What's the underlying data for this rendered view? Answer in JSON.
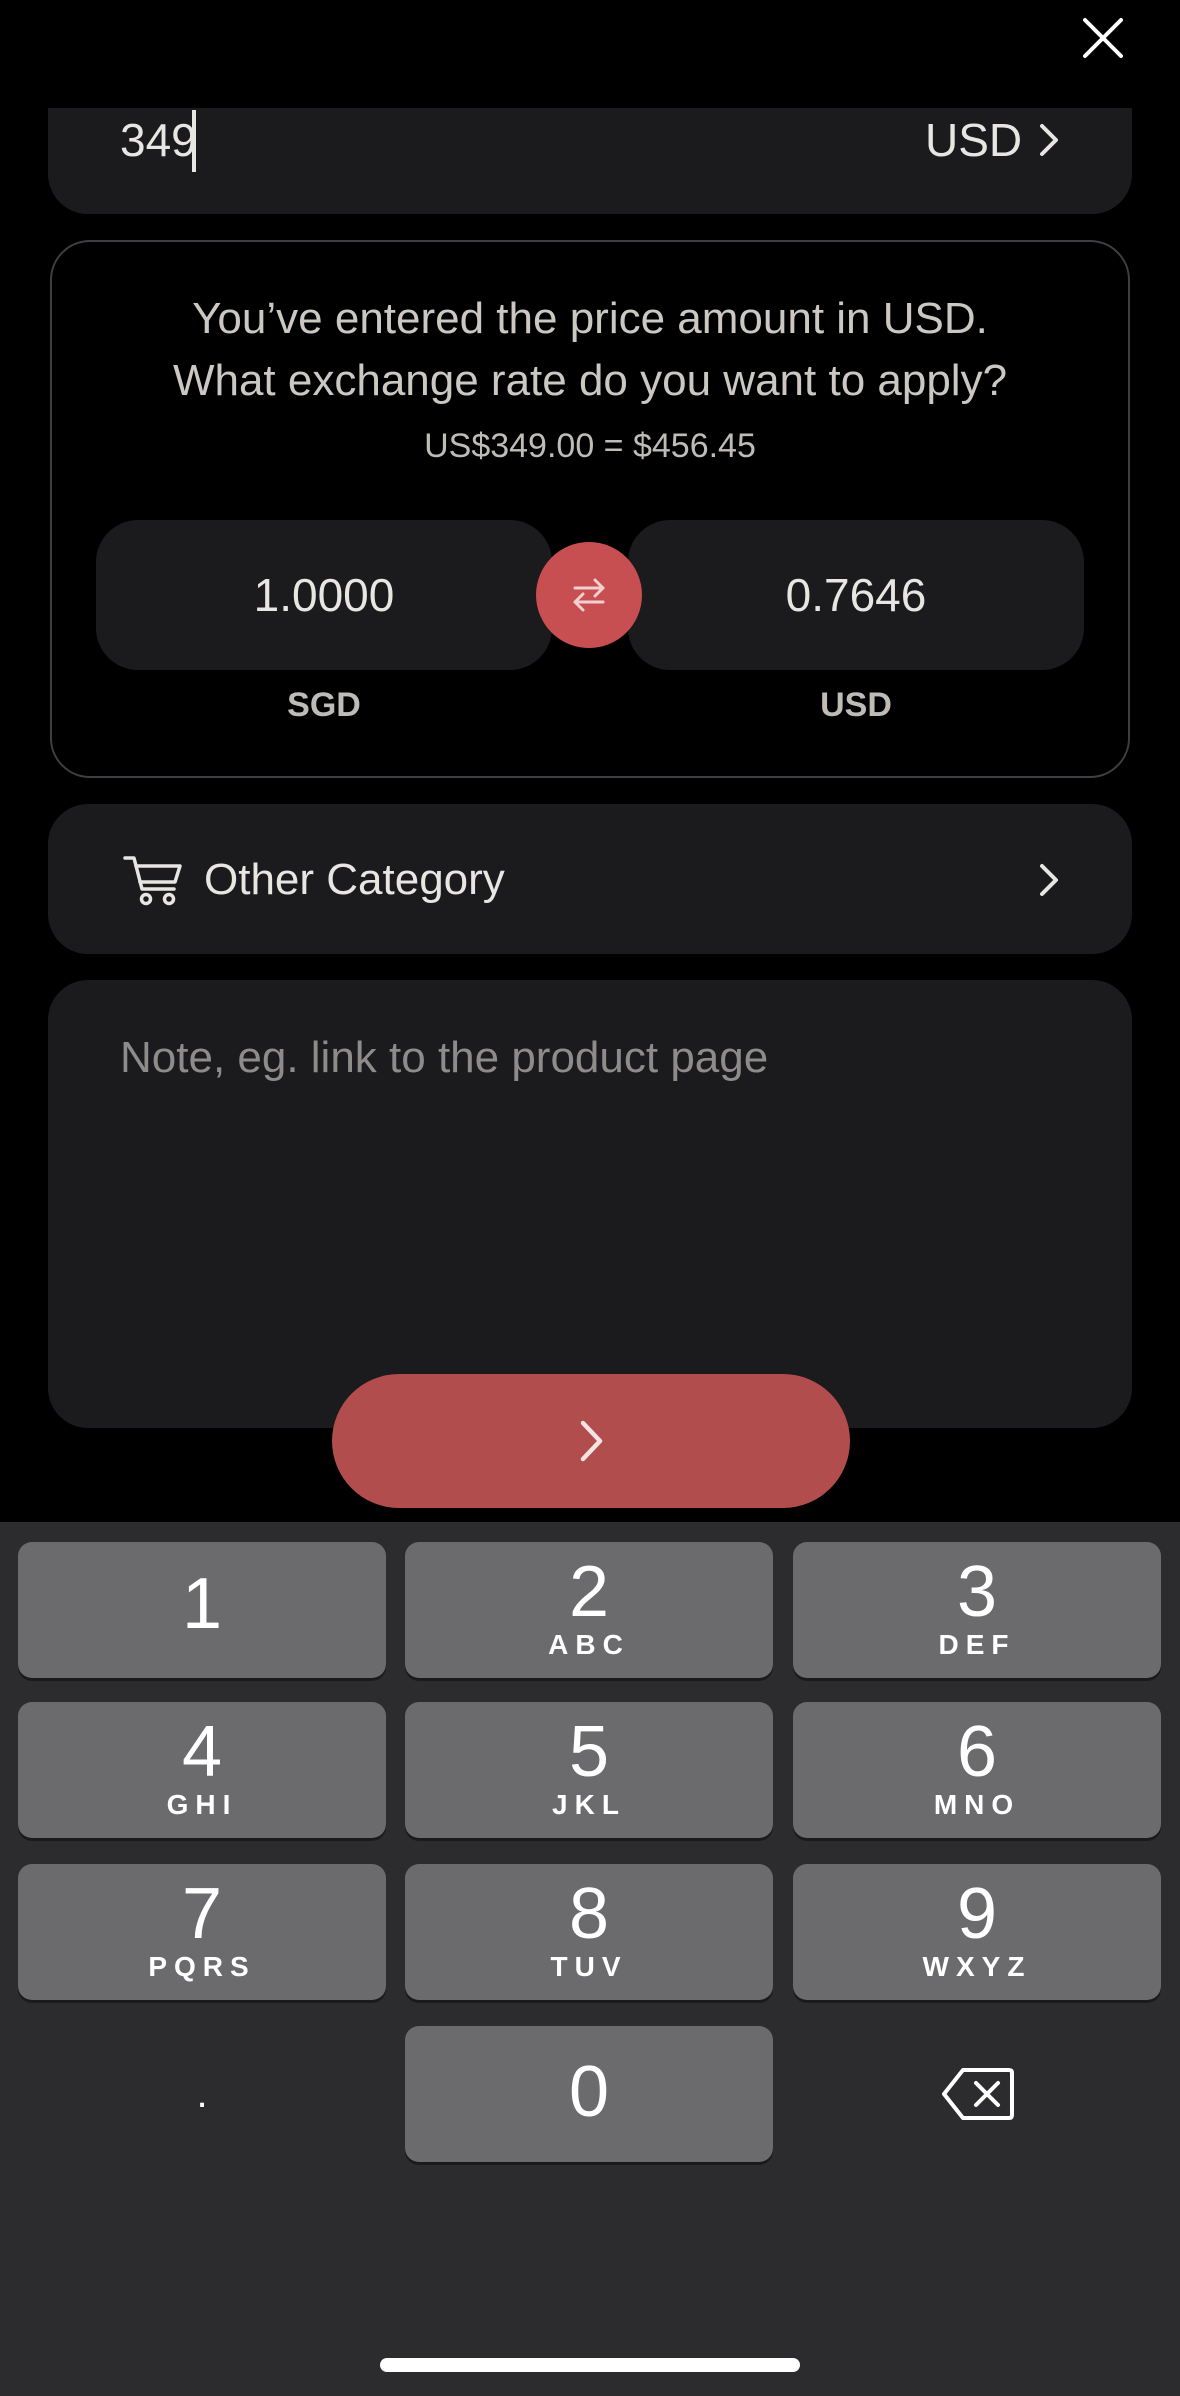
{
  "amount": {
    "value": "349",
    "currency": "USD"
  },
  "exchange": {
    "question_line1": "You’ve entered the price amount in USD.",
    "question_line2": "What exchange rate do you want to apply?",
    "equation": "US$349.00 = $456.45",
    "left_rate": "1.0000",
    "left_currency": "SGD",
    "right_rate": "0.7646",
    "right_currency": "USD"
  },
  "category": {
    "label": "Other Category"
  },
  "note": {
    "placeholder": "Note, eg. link to the product page"
  },
  "keypad": {
    "keys": [
      {
        "digit": "1",
        "letters": ""
      },
      {
        "digit": "2",
        "letters": "ABC"
      },
      {
        "digit": "3",
        "letters": "DEF"
      },
      {
        "digit": "4",
        "letters": "GHI"
      },
      {
        "digit": "5",
        "letters": "JKL"
      },
      {
        "digit": "6",
        "letters": "MNO"
      },
      {
        "digit": "7",
        "letters": "PQRS"
      },
      {
        "digit": "8",
        "letters": "TUV"
      },
      {
        "digit": "9",
        "letters": "WXYZ"
      },
      {
        "digit": "0",
        "letters": ""
      }
    ],
    "decimal": "."
  },
  "colors": {
    "accent": "#c74f51",
    "next_button": "#b24d4e",
    "card": "#1b1a1d",
    "key": "#6b6a6d",
    "keyboard_bg": "#2c2b2e"
  },
  "icons": {
    "close": "close-icon",
    "chevron": "chevron-right-icon",
    "swap": "swap-arrows-icon",
    "cart": "cart-icon",
    "next": "chevron-right-icon",
    "backspace": "backspace-icon"
  }
}
